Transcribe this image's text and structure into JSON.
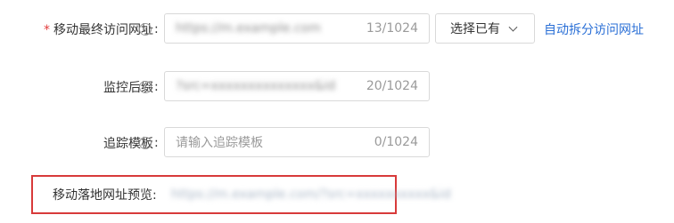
{
  "form": {
    "mobile_url": {
      "required_mark": "*",
      "label": "移动最终访问网址",
      "help_icon": "question-circle-icon",
      "colon": ":",
      "value": "https://m.example.com",
      "counter": "13/1024",
      "select_label": "选择已有",
      "select_icon": "chevron-down-icon",
      "link": "自动拆分访问网址"
    },
    "monitor_suffix": {
      "label": "监控后缀",
      "help_icon": "question-circle-icon",
      "colon": ":",
      "value": "?src=xxxxxxxxxxxxxx&id",
      "counter": "20/1024"
    },
    "tracking_template": {
      "label": "追踪模板",
      "help_icon": "question-circle-icon",
      "colon": ":",
      "placeholder": "请输入追踪模板",
      "counter": "0/1024"
    },
    "preview": {
      "label": "移动落地网址预览:",
      "value": "https://m.example.com/?src=xxxxxxxxxx&id"
    }
  },
  "colors": {
    "required": "#e23b3b",
    "link": "#2a6fd6",
    "highlight_border": "#d83a3a",
    "border": "#d9d9d9",
    "muted_text": "#9a9a9a"
  }
}
